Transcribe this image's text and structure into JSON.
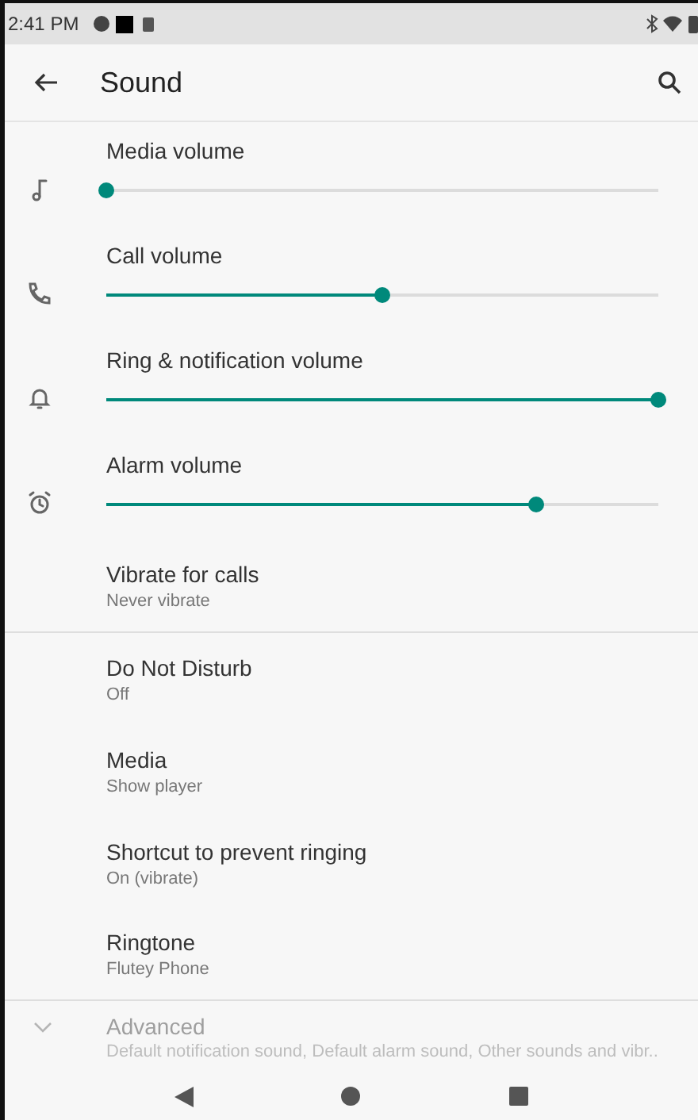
{
  "status_bar": {
    "time": "2:41 PM"
  },
  "app_bar": {
    "title": "Sound"
  },
  "volumes": [
    {
      "label": "Media volume",
      "kind": "media",
      "level": 0
    },
    {
      "label": "Call volume",
      "kind": "call",
      "level": 0.5
    },
    {
      "label": "Ring & notification volume",
      "kind": "ring",
      "level": 1
    },
    {
      "label": "Alarm volume",
      "kind": "alarm",
      "level": 0.78
    }
  ],
  "settings": [
    {
      "title": "Vibrate for calls",
      "summary": "Never vibrate",
      "divider_after": true
    },
    {
      "title": "Do Not Disturb",
      "summary": "Off",
      "divider_after": false
    },
    {
      "title": "Media",
      "summary": "Show player",
      "divider_after": false
    },
    {
      "title": "Shortcut to prevent ringing",
      "summary": "On (vibrate)",
      "divider_after": false
    },
    {
      "title": "Ringtone",
      "summary": "Flutey Phone",
      "divider_after": true
    }
  ],
  "advanced": {
    "title": "Advanced",
    "summary": "Default notification sound, Default alarm sound, Other sounds and vibr.."
  }
}
